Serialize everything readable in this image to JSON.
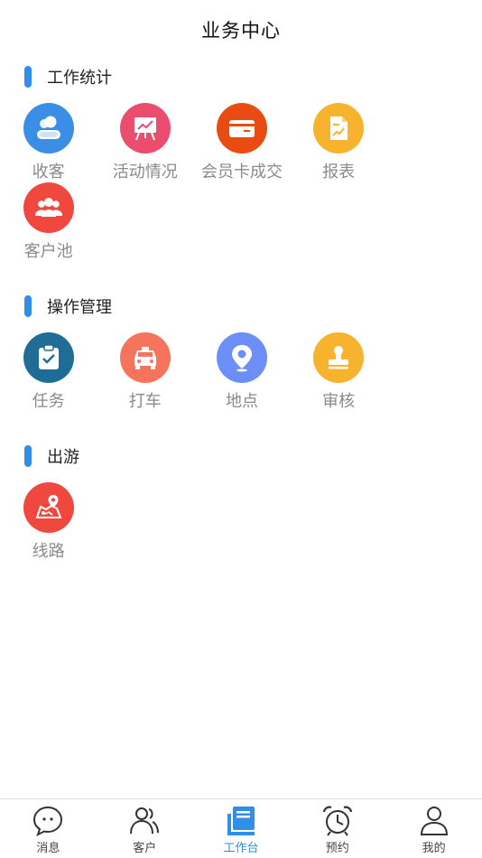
{
  "header": {
    "title": "业务中心"
  },
  "sections": {
    "work": {
      "title": "工作统计",
      "items": [
        {
          "label": "收客",
          "icon": "users-icon",
          "color": "#3a8ee6"
        },
        {
          "label": "活动情况",
          "icon": "presentation-chart-icon",
          "color": "#ea4d6d"
        },
        {
          "label": "会员卡成交",
          "icon": "credit-card-icon",
          "color": "#e84c12"
        },
        {
          "label": "报表",
          "icon": "report-icon",
          "color": "#f7b22e"
        },
        {
          "label": "客户池",
          "icon": "group-icon",
          "color": "#f0473f"
        }
      ]
    },
    "ops": {
      "title": "操作管理",
      "items": [
        {
          "label": "任务",
          "icon": "clipboard-check-icon",
          "color": "#1f6d96"
        },
        {
          "label": "打车",
          "icon": "taxi-icon",
          "color": "#f6735c"
        },
        {
          "label": "地点",
          "icon": "location-pin-icon",
          "color": "#6b8ff7"
        },
        {
          "label": "审核",
          "icon": "stamp-icon",
          "color": "#f7b22e"
        }
      ]
    },
    "travel": {
      "title": "出游",
      "items": [
        {
          "label": "线路",
          "icon": "route-map-icon",
          "color": "#f0473f"
        }
      ]
    }
  },
  "tabbar": {
    "active_color": "#2f8fe6",
    "items": [
      {
        "label": "消息",
        "icon": "chat-bubble-icon"
      },
      {
        "label": "客户",
        "icon": "customers-icon"
      },
      {
        "label": "工作台",
        "icon": "workbench-icon"
      },
      {
        "label": "预约",
        "icon": "alarm-clock-icon"
      },
      {
        "label": "我的",
        "icon": "profile-icon"
      }
    ]
  }
}
